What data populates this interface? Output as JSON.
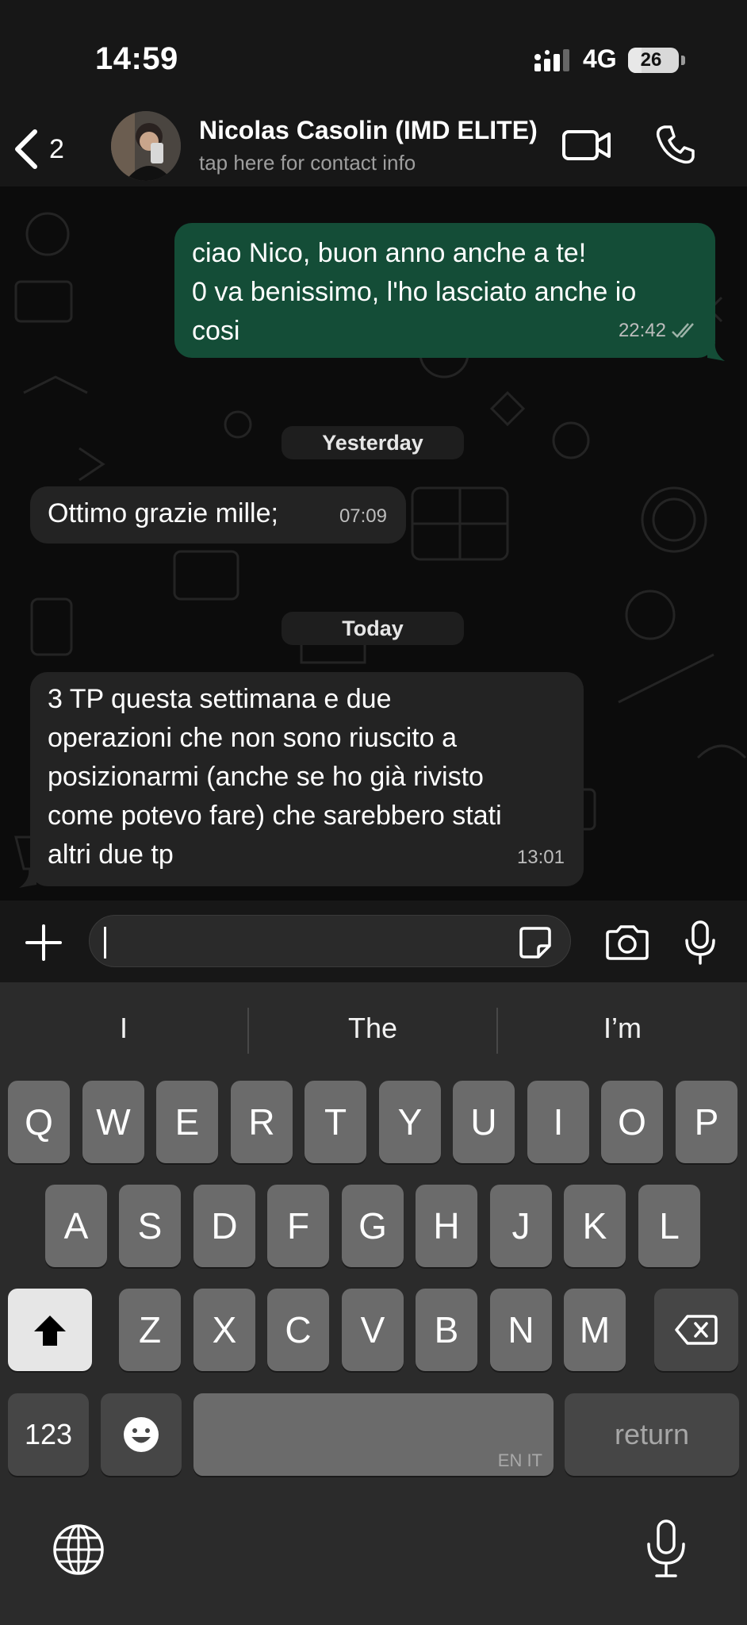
{
  "status_bar": {
    "time": "14:59",
    "network": "4G",
    "battery": "26",
    "battery_level": 0.26
  },
  "header": {
    "back_count": "2",
    "contact_name": "Nicolas Casolin (IMD ELITE)",
    "contact_subtitle": "tap here for contact info"
  },
  "messages": [
    {
      "direction": "outgoing",
      "lines": [
        "ciao Nico, buon anno anche a te!",
        "0 va benissimo, l'ho lasciato anche io",
        "cosi"
      ],
      "time": "22:42",
      "status": "read"
    },
    {
      "direction": "incoming",
      "lines": [
        "Ottimo grazie mille;"
      ],
      "time": "07:09"
    },
    {
      "direction": "incoming",
      "lines": [
        "3 TP questa settimana e due",
        "operazioni che non sono riuscito a",
        "posizionarmi (anche se ho già rivisto",
        "come potevo fare) che sarebbero stati",
        "altri due tp"
      ],
      "time": "13:01"
    }
  ],
  "date_separators": [
    "Yesterday",
    "Today"
  ],
  "composer": {
    "text": ""
  },
  "keyboard": {
    "suggestions": [
      "I",
      "The",
      "I’m"
    ],
    "row1": [
      "Q",
      "W",
      "E",
      "R",
      "T",
      "Y",
      "U",
      "I",
      "O",
      "P"
    ],
    "row2": [
      "A",
      "S",
      "D",
      "F",
      "G",
      "H",
      "J",
      "K",
      "L"
    ],
    "row3": [
      "Z",
      "X",
      "C",
      "V",
      "B",
      "N",
      "M"
    ],
    "numbers_label": "123",
    "space_sublabel": "EN IT",
    "return_label": "return"
  },
  "colors": {
    "outgoing_bubble": "#144d37",
    "incoming_bubble": "#232323",
    "background": "#0c0c0c",
    "keyboard": "#2b2b2b"
  },
  "icons": [
    "back-chevron-icon",
    "video-call-icon",
    "phone-icon",
    "plus-icon",
    "sticker-icon",
    "camera-icon",
    "microphone-icon",
    "shift-icon",
    "delete-icon",
    "emoji-icon",
    "globe-icon",
    "read-receipt-icon"
  ]
}
